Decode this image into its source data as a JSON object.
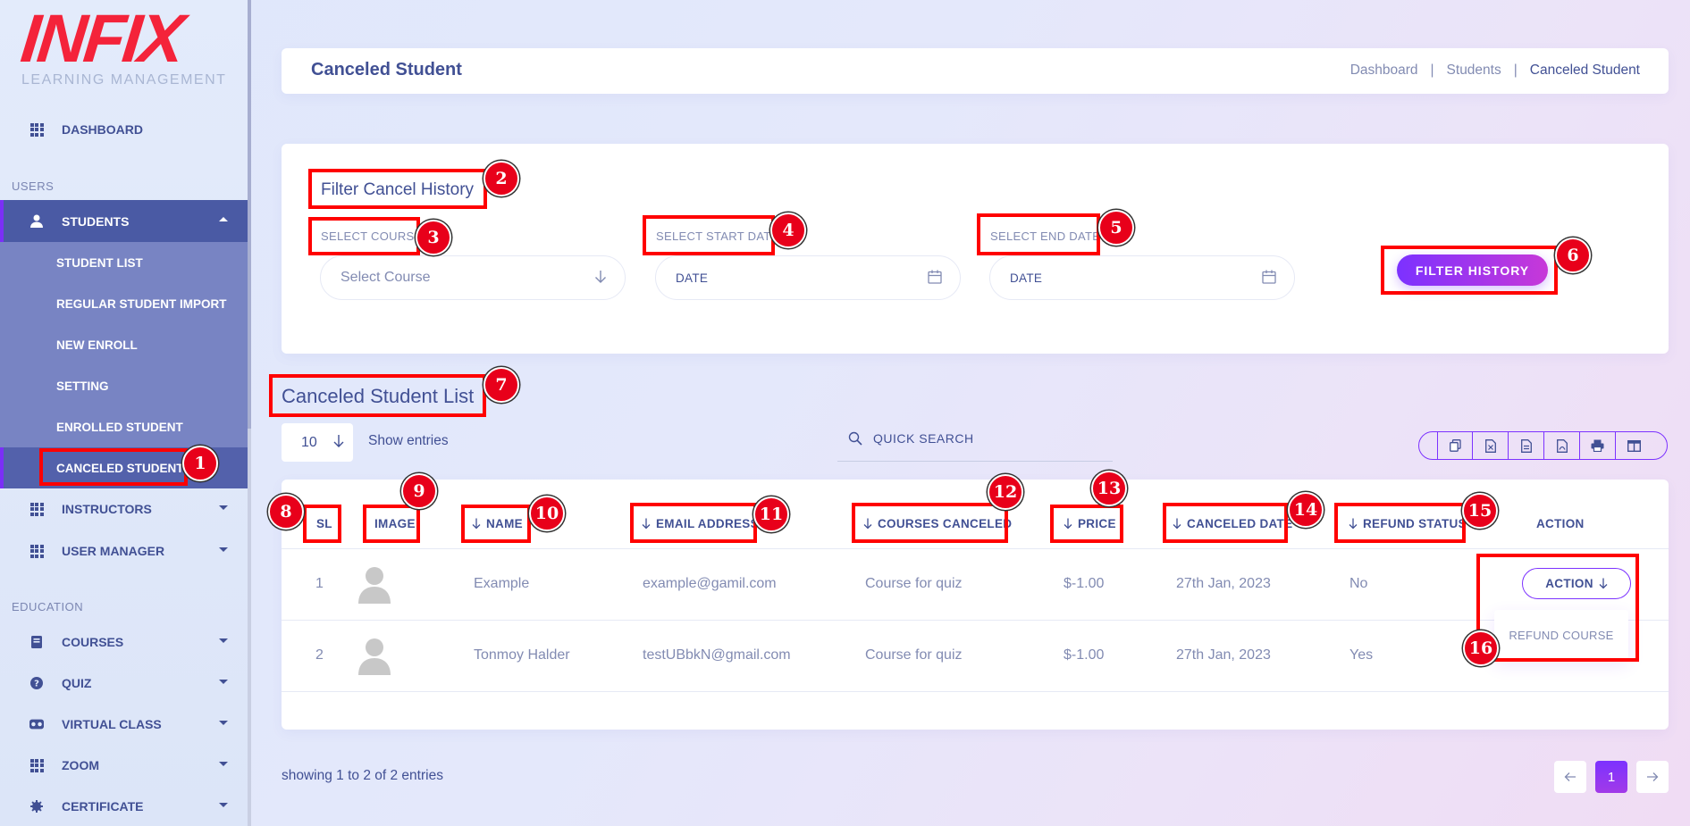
{
  "logo": {
    "brand": "INFIX",
    "tagline": "LEARNING MANAGEMENT"
  },
  "sidebar": {
    "sections": {
      "users": "USERS",
      "education": "EDUCATION"
    },
    "dashboard": "DASHBOARD",
    "students": "STUDENTS",
    "students_sub": [
      "STUDENT LIST",
      "REGULAR STUDENT IMPORT",
      "NEW ENROLL",
      "SETTING",
      "ENROLLED STUDENT",
      "CANCELED STUDENT"
    ],
    "instructors": "INSTRUCTORS",
    "user_manager": "USER MANAGER",
    "courses": "COURSES",
    "quiz": "QUIZ",
    "virtual_class": "VIRTUAL CLASS",
    "zoom": "ZOOM",
    "certificate": "CERTIFICATE"
  },
  "header": {
    "title": "Canceled Student",
    "breadcrumb": [
      "Dashboard",
      "Students",
      "Canceled Student"
    ],
    "sep": "|"
  },
  "filter": {
    "heading": "Filter Cancel History",
    "course_label": "SELECT COURSE",
    "course_placeholder": "Select Course",
    "start_label": "SELECT START DATE",
    "start_value": "DATE",
    "end_label": "SELECT END DATE",
    "end_value": "DATE",
    "button": "FILTER HISTORY"
  },
  "list": {
    "heading": "Canceled Student List",
    "entries": "10",
    "show_entries": "Show entries",
    "search_placeholder": "QUICK SEARCH",
    "columns": [
      "SL",
      "IMAGE",
      "NAME",
      "EMAIL ADDRESS",
      "COURSES CANCELED",
      "PRICE",
      "CANCELED DATE",
      "REFUND STATUS",
      "ACTION"
    ],
    "rows": [
      {
        "sl": "1",
        "name": "Example",
        "email": "example@gamil.com",
        "course": "Course for quiz",
        "price": "$-1.00",
        "date": "27th Jan, 2023",
        "refund": "No"
      },
      {
        "sl": "2",
        "name": "Tonmoy Halder",
        "email": "testUBbkN@gmail.com",
        "course": "Course for quiz",
        "price": "$-1.00",
        "date": "27th Jan, 2023",
        "refund": "Yes"
      }
    ],
    "action_button": "ACTION",
    "dropdown_item": "REFUND COURSE",
    "showing": "showing 1 to 2 of 2 entries",
    "page": "1"
  },
  "annotations": [
    "1",
    "2",
    "3",
    "4",
    "5",
    "6",
    "7",
    "8",
    "9",
    "10",
    "11",
    "12",
    "13",
    "14",
    "15",
    "16"
  ],
  "colors": {
    "accent": "#7c32ff",
    "primary_text": "#415094",
    "muted_text": "#828bb2",
    "annotation": "#ff0000",
    "logo": "#f4233a"
  }
}
